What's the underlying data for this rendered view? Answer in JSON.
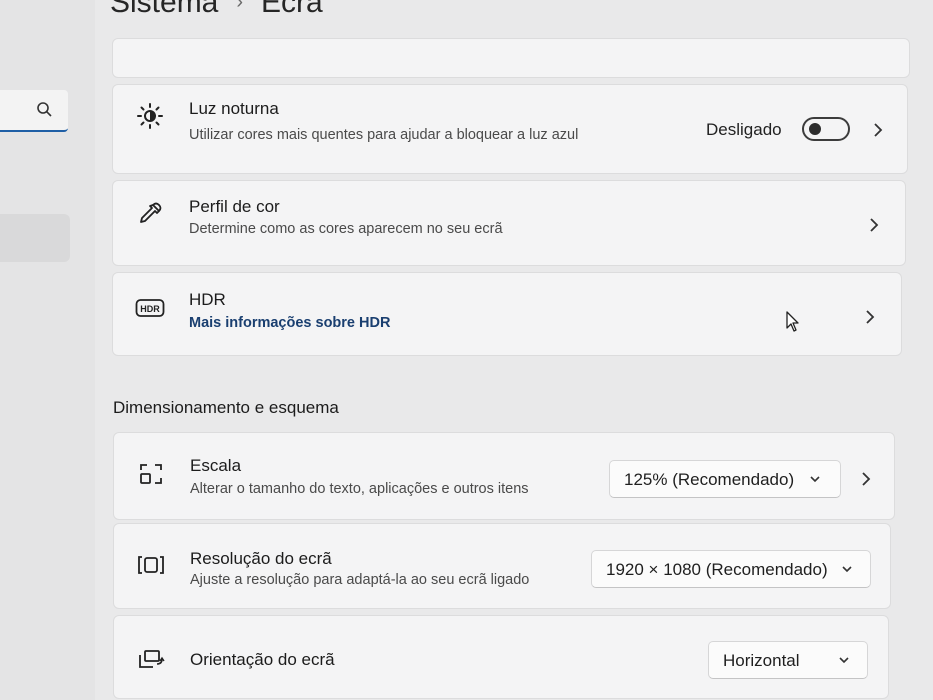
{
  "header": {
    "section": "Sistema",
    "page": "Ecrã"
  },
  "sidebar": {
    "search_icon": "search-icon"
  },
  "cards": {
    "night_light": {
      "title": "Luz noturna",
      "subtitle": "Utilizar cores mais quentes para ajudar a bloquear a luz azul",
      "status": "Desligado",
      "toggle_on": false,
      "icon": "brightness-icon"
    },
    "color_profile": {
      "title": "Perfil de cor",
      "subtitle": "Determine como as cores aparecem no seu ecrã",
      "icon": "eyedropper-icon"
    },
    "hdr": {
      "title": "HDR",
      "link": "Mais informações sobre HDR",
      "icon": "hdr-icon",
      "icon_text": "HDR"
    }
  },
  "scale_section": {
    "title": "Dimensionamento e esquema"
  },
  "scale": {
    "title": "Escala",
    "subtitle": "Alterar o tamanho do texto, aplicações e outros itens",
    "value": "125% (Recomendado)",
    "icon": "scale-icon"
  },
  "resolution": {
    "title": "Resolução do ecrã",
    "subtitle": "Ajuste a resolução para adaptá-la ao seu ecrã ligado",
    "value": "1920 × 1080 (Recomendado)",
    "icon": "resolution-icon"
  },
  "orientation": {
    "title": "Orientação do ecrã",
    "value": "Horizontal",
    "icon": "orientation-icon"
  },
  "colors": {
    "link": "#1a3f70",
    "accent": "#1f5fa6"
  }
}
